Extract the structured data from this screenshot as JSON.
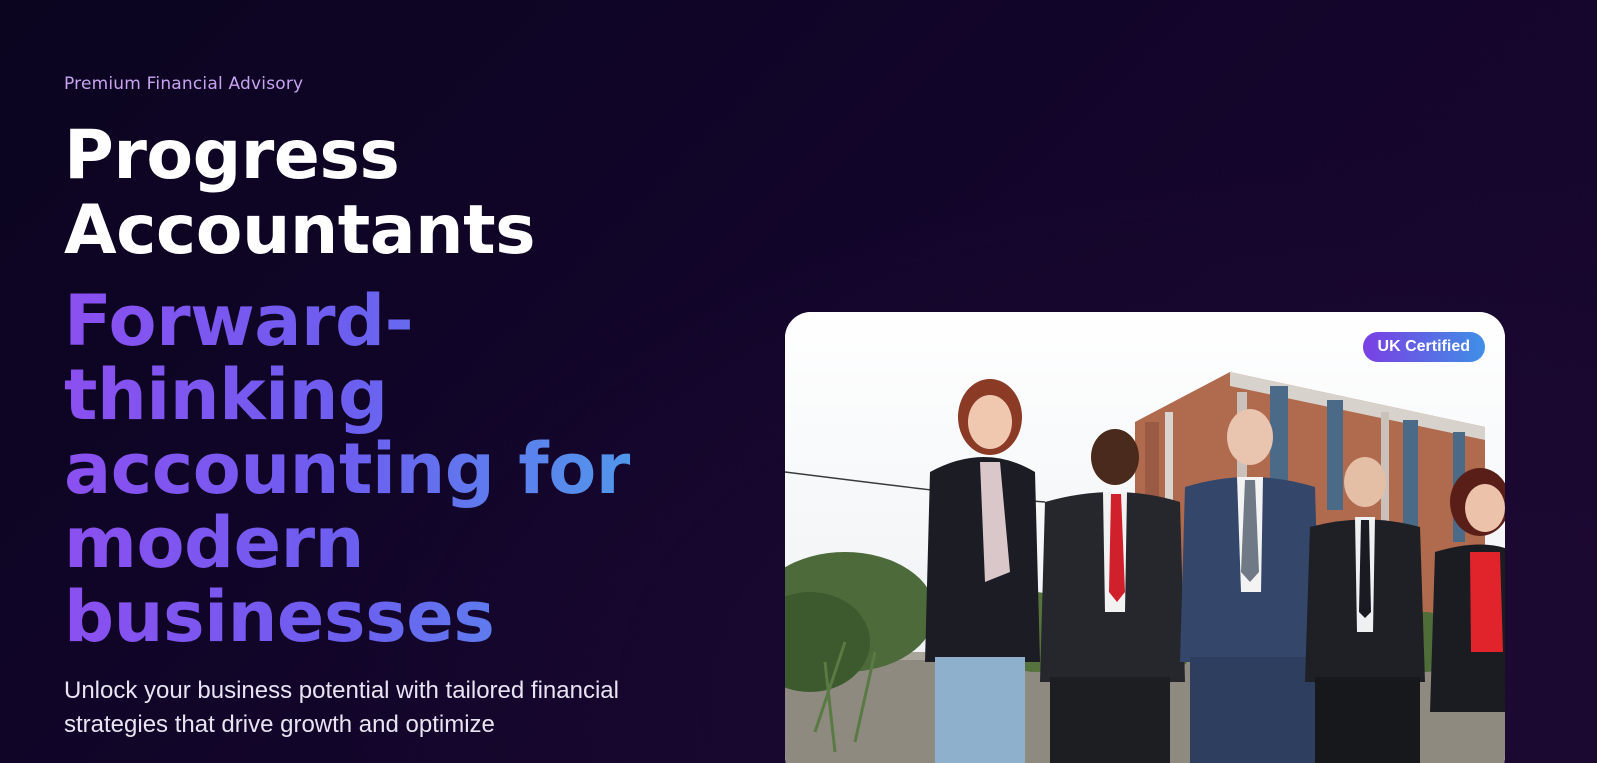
{
  "hero": {
    "eyebrow": "Premium Financial Advisory",
    "title_lines": [
      "Progress",
      "Accountants"
    ],
    "tagline_lines": [
      "Forward-",
      "thinking",
      "accounting for",
      "modern",
      "businesses"
    ],
    "description": "Unlock your business potential with tailored financial strategies that drive growth and optimize"
  },
  "photo": {
    "badge": "UK Certified"
  },
  "colors": {
    "eyebrow": "#c7a3f0",
    "gradient_start": "#8b4ff0",
    "gradient_end": "#4aa6ea",
    "background": "#12052a"
  }
}
